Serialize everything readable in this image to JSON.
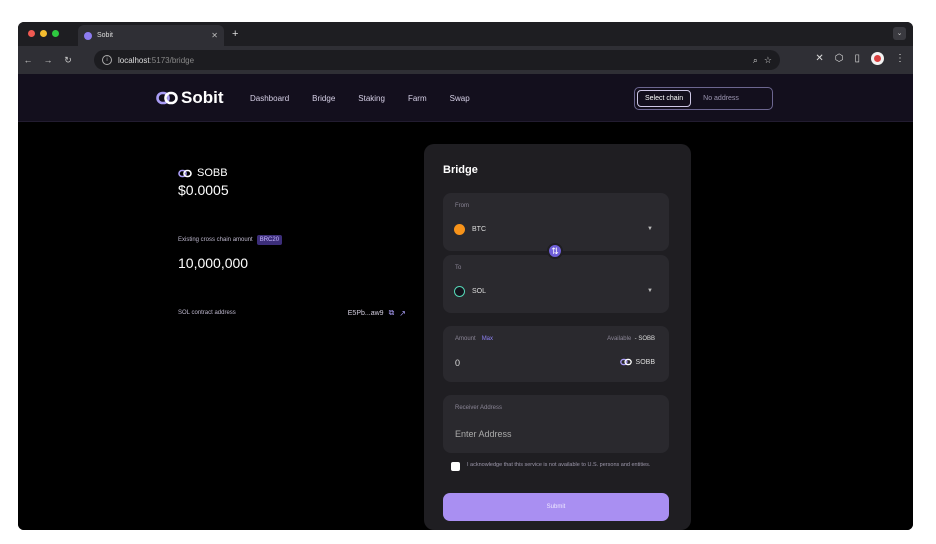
{
  "browser": {
    "tab_title": "Sobit",
    "tab_new": "+",
    "url_host": "localhost",
    "url_path": ":5173/bridge"
  },
  "app": {
    "logo": "Sobit",
    "nav": [
      "Dashboard",
      "Bridge",
      "Staking",
      "Farm",
      "Swap"
    ],
    "chain_select": "Select chain",
    "no_address": "No address"
  },
  "info": {
    "token_name": "SOBB",
    "price": "$0.0005",
    "cross_chain_label": "Existing cross chain amount",
    "cross_chain_badge": "BRC20",
    "cross_chain_amount": "10,000,000",
    "sol_label": "SOL contract address",
    "sol_address": "E5Pb...aw9"
  },
  "bridge": {
    "title": "Bridge",
    "from_label": "From",
    "from_token": "BTC",
    "to_label": "To",
    "to_token": "SOL",
    "amount_label": "Amount",
    "max_label": "Max",
    "available_label": "Available",
    "available_value": "- SOBB",
    "amount_value": "0",
    "amount_token": "SOBB",
    "receiver_label": "Receiver Address",
    "receiver_placeholder": "Enter Address",
    "ack_text": "I acknowledge that this service is not available to U.S. persons and entities.",
    "submit_label": "Submit"
  },
  "colors": {
    "accent": "#a98ff2",
    "btc": "#f7931a",
    "panel": "#1f1e22"
  },
  "icons": [
    "back-icon",
    "forward-icon",
    "reload-icon",
    "info-icon",
    "zoom-icon",
    "star-icon",
    "extension-icon",
    "puzzle-icon",
    "sidepanel-icon",
    "profile-icon",
    "menu-icon",
    "swap-icon",
    "copy-icon",
    "external-link-icon",
    "chevron-down-icon",
    "link-icon"
  ]
}
